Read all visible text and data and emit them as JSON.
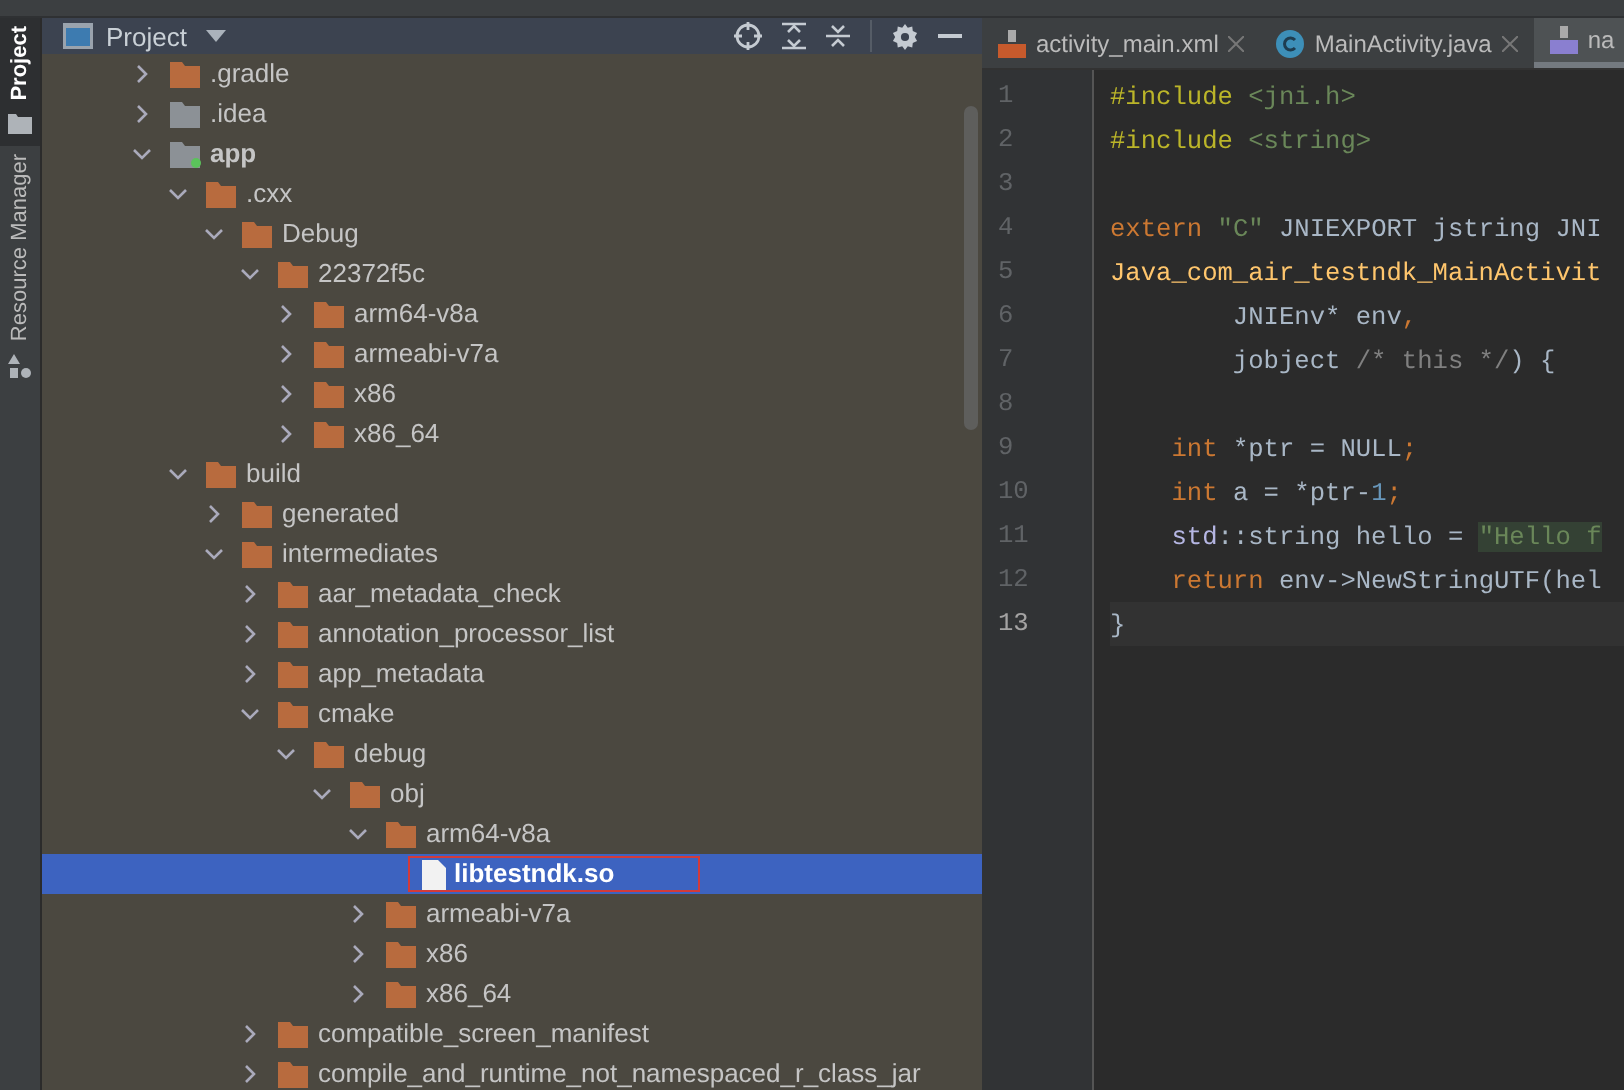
{
  "tool_strip": [
    {
      "label": "Project",
      "kind": "project",
      "selected": true
    },
    {
      "label": "Resource Manager",
      "kind": "resources",
      "selected": false
    }
  ],
  "project_panel": {
    "title": "Project",
    "tree": [
      {
        "label": ".gradle",
        "kind": "folder",
        "expanded": false,
        "selected": false
      },
      {
        "label": ".idea",
        "kind": "config-folder",
        "expanded": false,
        "selected": false
      },
      {
        "label": "app",
        "kind": "module",
        "expanded": true,
        "selected": false,
        "children": [
          {
            "label": ".cxx",
            "kind": "folder",
            "expanded": true,
            "selected": false,
            "children": [
              {
                "label": "Debug",
                "kind": "folder",
                "expanded": true,
                "selected": false,
                "children": [
                  {
                    "label": "22372f5c",
                    "kind": "folder",
                    "expanded": true,
                    "selected": false,
                    "children": [
                      {
                        "label": "arm64-v8a",
                        "kind": "folder",
                        "expanded": false,
                        "selected": false
                      },
                      {
                        "label": "armeabi-v7a",
                        "kind": "folder",
                        "expanded": false,
                        "selected": false
                      },
                      {
                        "label": "x86",
                        "kind": "folder",
                        "expanded": false,
                        "selected": false
                      },
                      {
                        "label": "x86_64",
                        "kind": "folder",
                        "expanded": false,
                        "selected": false
                      }
                    ]
                  }
                ]
              }
            ]
          },
          {
            "label": "build",
            "kind": "folder",
            "expanded": true,
            "selected": false,
            "children": [
              {
                "label": "generated",
                "kind": "folder",
                "expanded": false,
                "selected": false
              },
              {
                "label": "intermediates",
                "kind": "folder",
                "expanded": true,
                "selected": false,
                "children": [
                  {
                    "label": "aar_metadata_check",
                    "kind": "folder",
                    "expanded": false,
                    "selected": false
                  },
                  {
                    "label": "annotation_processor_list",
                    "kind": "folder",
                    "expanded": false,
                    "selected": false
                  },
                  {
                    "label": "app_metadata",
                    "kind": "folder",
                    "expanded": false,
                    "selected": false
                  },
                  {
                    "label": "cmake",
                    "kind": "folder",
                    "expanded": true,
                    "selected": false,
                    "children": [
                      {
                        "label": "debug",
                        "kind": "folder",
                        "expanded": true,
                        "selected": false,
                        "children": [
                          {
                            "label": "obj",
                            "kind": "folder",
                            "expanded": true,
                            "selected": false,
                            "children": [
                              {
                                "label": "arm64-v8a",
                                "kind": "folder",
                                "expanded": true,
                                "selected": false,
                                "children": [
                                  {
                                    "label": "libtestndk.so",
                                    "kind": "file",
                                    "selected": true,
                                    "outlined": true
                                  }
                                ]
                              },
                              {
                                "label": "armeabi-v7a",
                                "kind": "folder",
                                "expanded": false,
                                "selected": false
                              },
                              {
                                "label": "x86",
                                "kind": "folder",
                                "expanded": false,
                                "selected": false
                              },
                              {
                                "label": "x86_64",
                                "kind": "folder",
                                "expanded": false,
                                "selected": false
                              }
                            ]
                          }
                        ]
                      }
                    ]
                  },
                  {
                    "label": "compatible_screen_manifest",
                    "kind": "folder",
                    "expanded": false,
                    "selected": false
                  },
                  {
                    "label": "compile_and_runtime_not_namespaced_r_class_jar",
                    "kind": "folder",
                    "expanded": false,
                    "selected": false
                  }
                ]
              }
            ]
          }
        ]
      }
    ]
  },
  "editor": {
    "tabs": [
      {
        "label": "activity_main.xml",
        "kind": "xml",
        "selected": false,
        "closable": true
      },
      {
        "label": "MainActivity.java",
        "kind": "java",
        "selected": false,
        "closable": true
      },
      {
        "label": "na",
        "kind": "cpp",
        "selected": true,
        "closable": false
      }
    ],
    "lines": [
      {
        "number": "1",
        "current": false,
        "tokens": [
          {
            "kind": "preprocessor",
            "text": "#include "
          },
          {
            "kind": "include",
            "text": "<jni.h>"
          }
        ]
      },
      {
        "number": "2",
        "current": false,
        "tokens": [
          {
            "kind": "preprocessor",
            "text": "#include "
          },
          {
            "kind": "include",
            "text": "<string>"
          }
        ]
      },
      {
        "number": "3",
        "current": false
      },
      {
        "number": "4",
        "current": false,
        "tokens": [
          {
            "kind": "keyword",
            "text": "extern "
          },
          {
            "kind": "string",
            "text": "\"C\""
          },
          {
            "kind": "plain",
            "text": " JNIEXPORT jstring JNI"
          }
        ]
      },
      {
        "number": "5",
        "current": false,
        "tokens": [
          {
            "kind": "function",
            "text": "Java_com_air_testndk_MainActivit"
          }
        ]
      },
      {
        "number": "6",
        "current": false,
        "tokens": [
          {
            "kind": "plain",
            "text": "        JNIEnv* env"
          },
          {
            "kind": "keyword",
            "text": ","
          }
        ]
      },
      {
        "number": "7",
        "current": false,
        "tokens": [
          {
            "kind": "plain",
            "text": "        jobject "
          },
          {
            "kind": "comment",
            "text": "/* this */"
          },
          {
            "kind": "plain",
            "text": ") {"
          }
        ]
      },
      {
        "number": "8",
        "current": false
      },
      {
        "number": "9",
        "current": false,
        "tokens": [
          {
            "kind": "keyword",
            "text": "    int "
          },
          {
            "kind": "plain",
            "text": "*ptr = NULL"
          },
          {
            "kind": "keyword",
            "text": ";"
          }
        ]
      },
      {
        "number": "10",
        "current": false,
        "tokens": [
          {
            "kind": "keyword",
            "text": "    int "
          },
          {
            "kind": "plain",
            "text": "a = *ptr-"
          },
          {
            "kind": "number",
            "text": "1"
          },
          {
            "kind": "keyword",
            "text": ";"
          }
        ]
      },
      {
        "number": "11",
        "current": false,
        "tokens": [
          {
            "kind": "namespace",
            "text": "    std"
          },
          {
            "kind": "plain",
            "text": "::string hello = "
          },
          {
            "kind": "string-highlight",
            "text": "\"Hello f"
          }
        ]
      },
      {
        "number": "12",
        "current": false,
        "tokens": [
          {
            "kind": "keyword",
            "text": "    return "
          },
          {
            "kind": "plain",
            "text": "env->NewStringUTF(hel"
          }
        ]
      },
      {
        "number": "13",
        "current": true,
        "tokens": [
          {
            "kind": "plain",
            "text": "}"
          }
        ]
      }
    ]
  }
}
